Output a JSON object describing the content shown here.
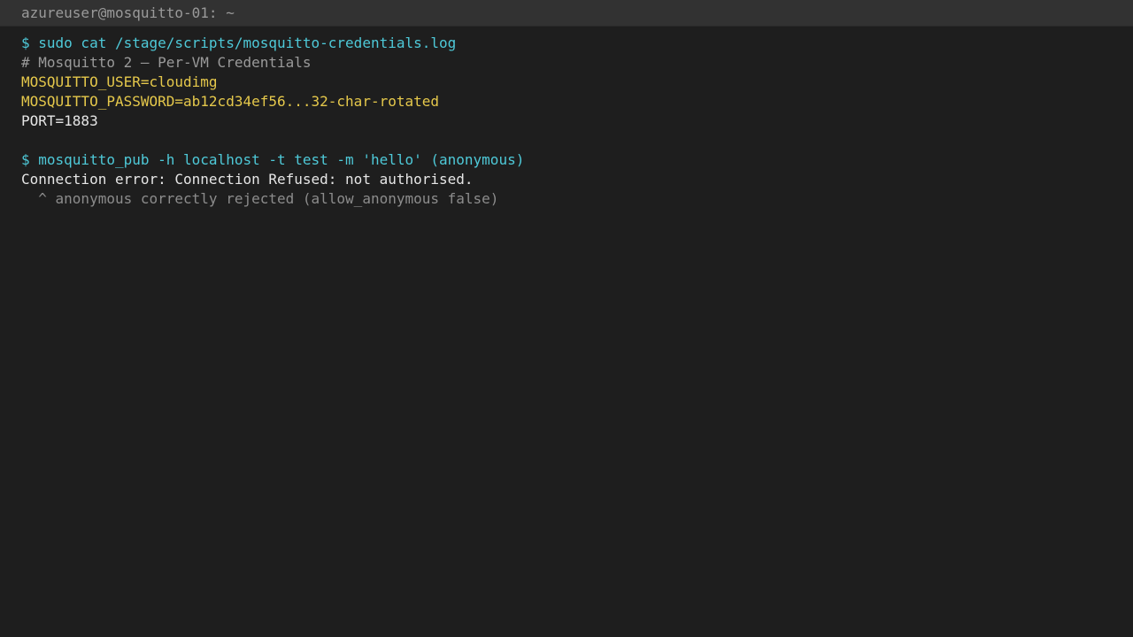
{
  "window": {
    "title": "azureuser@mosquitto-01: ~"
  },
  "terminal": {
    "lines": [
      {
        "text": "$ sudo cat /stage/scripts/mosquitto-credentials.log",
        "kind": "command"
      },
      {
        "text": "# Mosquitto 2 — Per-VM Credentials",
        "kind": "comment"
      },
      {
        "text": "MOSQUITTO_USER=cloudimg",
        "kind": "env"
      },
      {
        "text": "MOSQUITTO_PASSWORD=ab12cd34ef56...32-char-rotated",
        "kind": "env"
      },
      {
        "text": "PORT=1883",
        "kind": "output"
      },
      {
        "text": "",
        "kind": "blank"
      },
      {
        "text": "$ mosquitto_pub -h localhost -t test -m 'hello' (anonymous)",
        "kind": "command"
      },
      {
        "text": "Connection error: Connection Refused: not authorised.",
        "kind": "output"
      },
      {
        "text": "  ^ anonymous correctly rejected (allow_anonymous false)",
        "kind": "note"
      }
    ]
  },
  "colors": {
    "background": "#1e1e1e",
    "titlebar": "#323232",
    "command": "#4ec9d8",
    "comment": "#9a9a9a",
    "env": "#e5c84b",
    "output": "#e6e6e6",
    "note": "#8c8c8c"
  }
}
